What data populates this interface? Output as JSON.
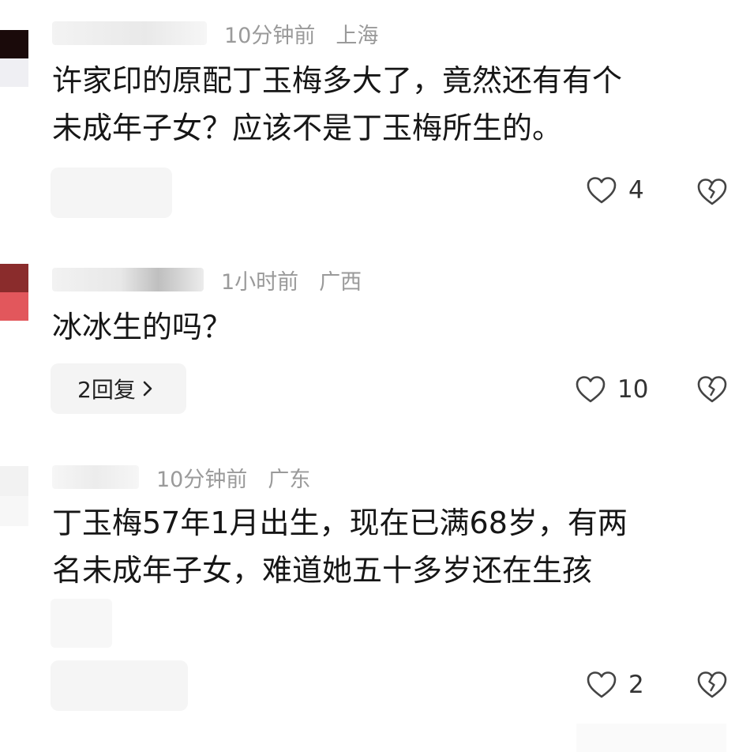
{
  "comments": [
    {
      "time": "10分钟前",
      "location": "上海",
      "text_lines": [
        "许家印的原配丁玉梅多大了，竟然还有有个",
        "未成年子女？应该不是丁玉梅所生的。"
      ],
      "likes": "4",
      "avatar_colors": [
        "#1a0a0a",
        "#efeff3"
      ]
    },
    {
      "time": "1小时前",
      "location": "广西",
      "text_lines": [
        "冰冰生的吗？"
      ],
      "likes": "10",
      "reply_label": "2回复",
      "avatar_colors": [
        "#8a2c2c",
        "#e2575c"
      ]
    },
    {
      "time": "10分钟前",
      "location": "广东",
      "text_lines": [
        "丁玉梅57年1月出生，现在已满68岁，有两",
        "名未成年子女，难道她五十多岁还在生孩"
      ],
      "likes": "2",
      "avatar_colors": [
        "#f2f2f2",
        "#f7f7f7"
      ]
    }
  ]
}
